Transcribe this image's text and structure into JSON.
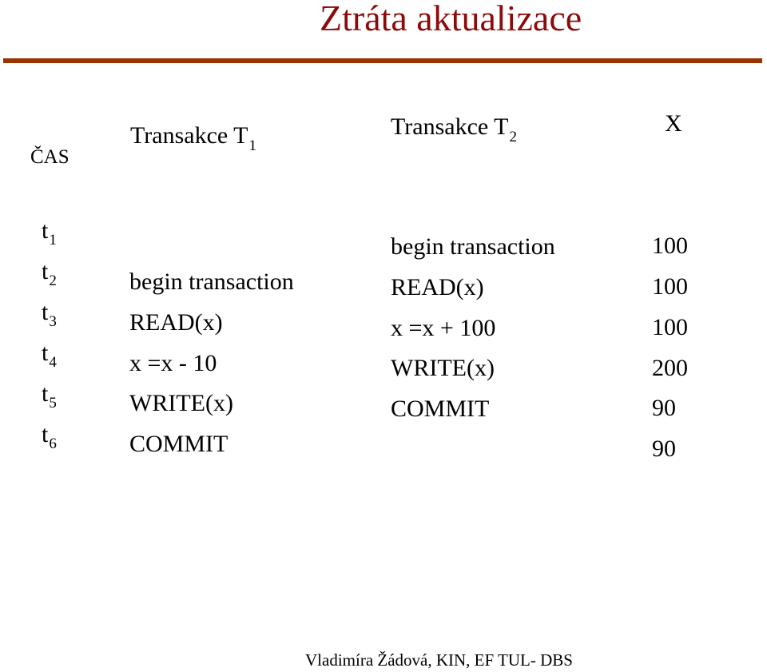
{
  "title": "Ztráta aktualizace",
  "colors": {
    "title": "#8b0b0b",
    "rule": "#993300"
  },
  "headers": {
    "time": "ČAS",
    "t1": {
      "label": "Transakce T",
      "sub": "1"
    },
    "t2": {
      "label": "Transakce T",
      "sub": "2"
    },
    "x": "X"
  },
  "times": [
    {
      "label": "t",
      "sub": "1"
    },
    {
      "label": "t",
      "sub": "2"
    },
    {
      "label": "t",
      "sub": "3"
    },
    {
      "label": "t",
      "sub": "4"
    },
    {
      "label": "t",
      "sub": "5"
    },
    {
      "label": "t",
      "sub": "6"
    }
  ],
  "transaction1": [
    "begin transaction",
    "READ(x)",
    "x =x - 10",
    "WRITE(x)",
    "COMMIT"
  ],
  "transaction2": [
    "begin transaction",
    "READ(x)",
    "x =x + 100",
    "WRITE(x)",
    "COMMIT"
  ],
  "x_values": [
    "100",
    "100",
    "100",
    "200",
    "90",
    "90"
  ],
  "footer": "Vladimíra Žádová, KIN, EF TUL- DBS"
}
